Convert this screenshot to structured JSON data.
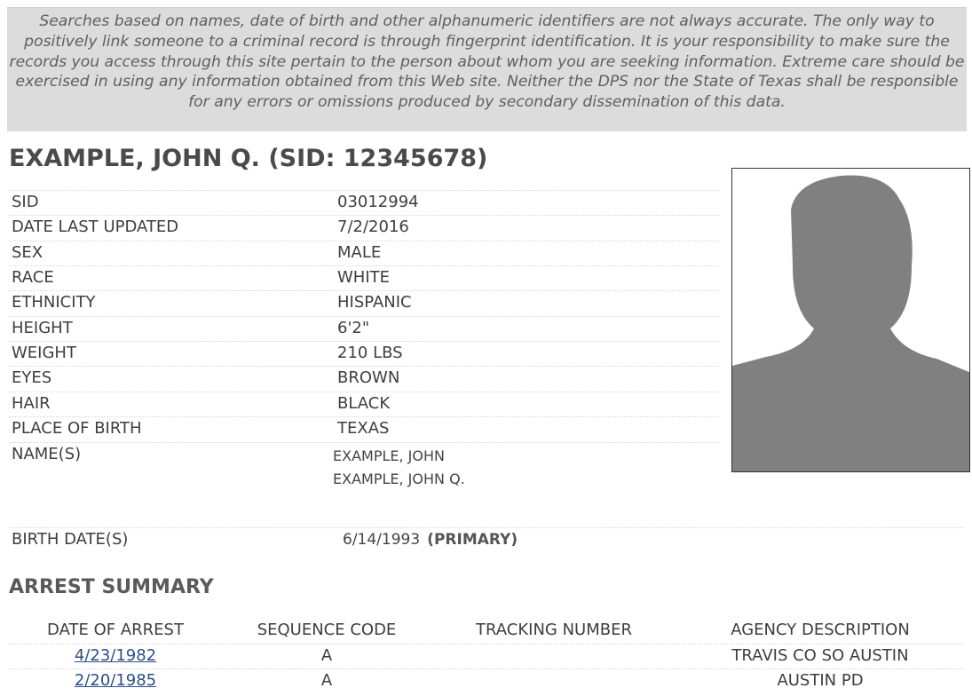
{
  "disclaimer": {
    "text": "Searches based on names, date of birth and other alphanumeric identifiers are not always accurate. The only way to positively link someone to a criminal record is through fingerprint identification. It is your responsibility to make sure the records you access through this site pertain to the person about whom you are seeking information. Extreme care should be exercised in using any information obtained from this Web site. Neither the DPS nor the State of Texas shall be responsible for any errors or omissions produced by secondary dissemination of this data."
  },
  "person": {
    "title": "EXAMPLE, JOHN Q. (SID: 12345678)",
    "details": [
      {
        "label": "SID",
        "value": "03012994"
      },
      {
        "label": "DATE LAST UPDATED",
        "value": "7/2/2016"
      },
      {
        "label": "SEX",
        "value": "MALE"
      },
      {
        "label": "RACE",
        "value": "WHITE"
      },
      {
        "label": "ETHNICITY",
        "value": "HISPANIC"
      },
      {
        "label": "HEIGHT",
        "value": "6'2\""
      },
      {
        "label": "WEIGHT",
        "value": "210 LBS"
      },
      {
        "label": "EYES",
        "value": "BROWN"
      },
      {
        "label": "HAIR",
        "value": "BLACK"
      },
      {
        "label": "PLACE OF BIRTH",
        "value": "TEXAS"
      }
    ],
    "names_label": "NAME(S)",
    "names": [
      "EXAMPLE, JOHN",
      "EXAMPLE, JOHN Q."
    ],
    "birth_label": "BIRTH DATE(S)",
    "birth_date": "6/14/1993",
    "birth_tag": "(PRIMARY)",
    "photo_icon": "person-silhouette-icon"
  },
  "arrest_summary": {
    "title": "ARREST SUMMARY",
    "headers": [
      "DATE OF ARREST",
      "SEQUENCE CODE",
      "TRACKING NUMBER",
      "AGENCY DESCRIPTION"
    ],
    "rows": [
      {
        "date": "4/23/1982",
        "sequence": "A",
        "tracking": "",
        "agency": "TRAVIS CO SO AUSTIN"
      },
      {
        "date": "2/20/1985",
        "sequence": "A",
        "tracking": "",
        "agency": "AUSTIN PD"
      }
    ]
  },
  "colors": {
    "disclaimer_bg": "#dcdcdc",
    "link": "#2c4f86",
    "silhouette": "#808080"
  }
}
